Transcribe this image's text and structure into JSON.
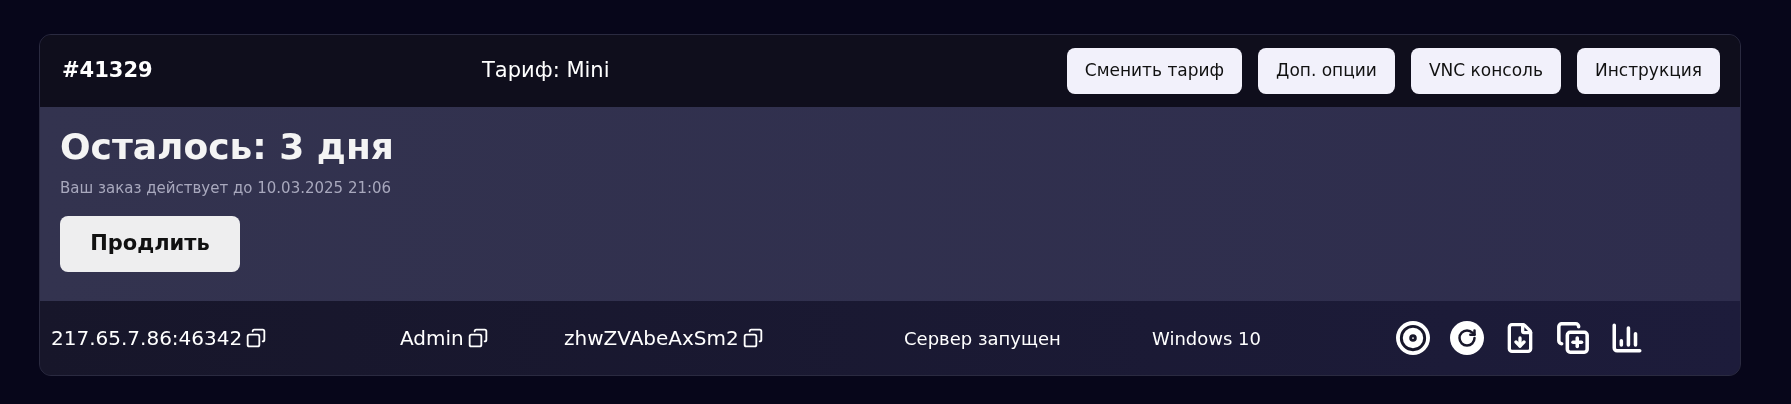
{
  "header": {
    "order_id": "#41329",
    "tariff": "Тариф: Mini",
    "buttons": [
      "Сменить тариф",
      "Доп. опции",
      "VNC консоль",
      "Инструкция"
    ]
  },
  "status": {
    "title": "Осталось: 3 дня",
    "subtitle": "Ваш заказ действует до 10.03.2025 21:06",
    "button": "Продлить"
  },
  "server": {
    "address": "217.65.7.86:46342",
    "login": "Admin",
    "password": "zhwZVAbeAxSm2",
    "state": "Сервер запущен",
    "os": "Windows 10"
  }
}
